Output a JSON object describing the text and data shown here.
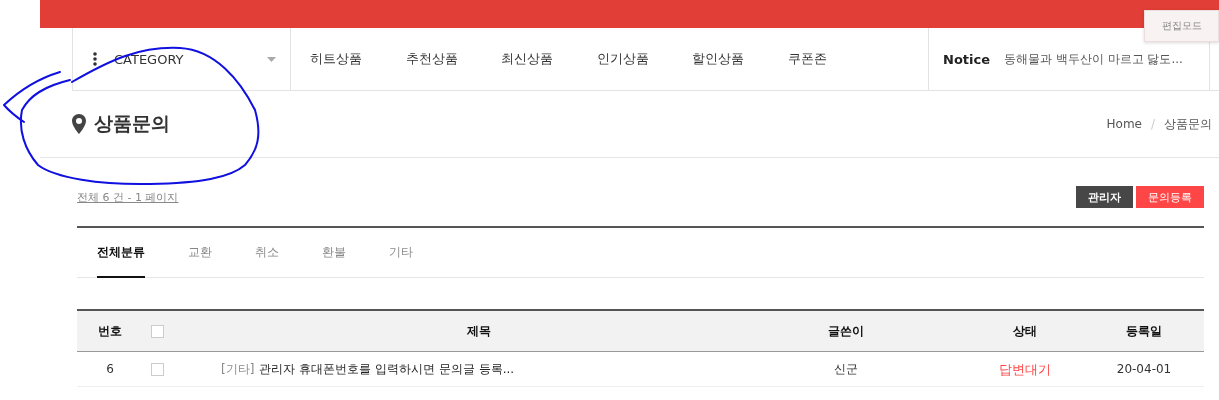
{
  "edit_mode_label": "편집모드",
  "nav": {
    "category_label": "CATEGORY",
    "menu": [
      {
        "label": "히트상품"
      },
      {
        "label": "추천상품"
      },
      {
        "label": "최신상품"
      },
      {
        "label": "인기상품"
      },
      {
        "label": "할인상품"
      },
      {
        "label": "쿠폰존"
      }
    ],
    "notice": {
      "label": "Notice",
      "text": "동해물과 백두산이 마르고 닳도..."
    }
  },
  "page_title": "상품문의",
  "breadcrumb": [
    {
      "label": "Home"
    },
    {
      "label": "상품문의"
    }
  ],
  "breadcrumb_separator": "/",
  "count_text": "전체 6 건 - 1 페이지",
  "buttons": [
    {
      "label": "관리자",
      "kind": "dark"
    },
    {
      "label": "문의등록",
      "kind": "primary"
    }
  ],
  "tabs": [
    {
      "label": "전체분류",
      "selected": true
    },
    {
      "label": "교환",
      "selected": false
    },
    {
      "label": "취소",
      "selected": false
    },
    {
      "label": "환불",
      "selected": false
    },
    {
      "label": "기타",
      "selected": false
    }
  ],
  "table": {
    "columns": [
      "번호",
      "제목",
      "글쓴이",
      "상태",
      "등록일"
    ],
    "select_all_checked": false,
    "rows": [
      {
        "number": "6",
        "checked": false,
        "category": "[기타]",
        "title": "관리자 휴대폰번호를 입력하시면 문의글 등록...",
        "author": "신군",
        "status": "답변대기",
        "color": "#ff4646",
        "date": "20-04-01"
      }
    ]
  }
}
